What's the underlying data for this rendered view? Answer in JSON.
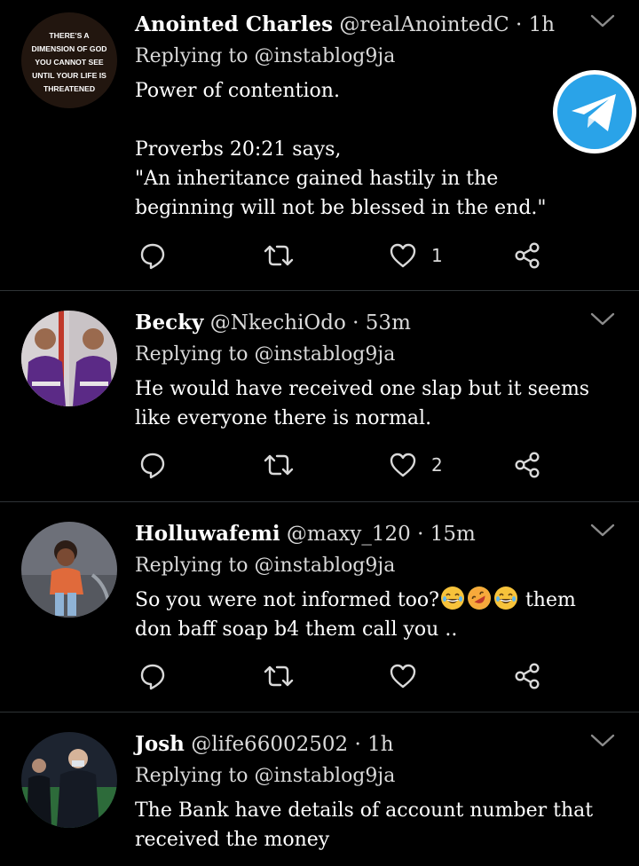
{
  "colors": {
    "background": "#000000",
    "text": "#ffffff",
    "muted": "#d9d9d9",
    "divider": "#2f3336",
    "telegram_blue": "#2aa3e8"
  },
  "floating_button": {
    "icon": "telegram-icon"
  },
  "tweets": [
    {
      "name": "Anointed Charles",
      "handle": "@realAnointedC",
      "separator": "·",
      "time": "1h",
      "replying_to": "Replying to @instablog9ja",
      "body": "Power of contention.\n\nProverbs 20:21 says,\n\"An inheritance gained hastily in the beginning will not be blessed in the end.\"",
      "avatar_text": [
        "THERE'S A",
        "DIMENSION OF GOD",
        "YOU CANNOT SEE",
        "UNTIL YOUR LIFE IS",
        "THREATENED"
      ],
      "likes": "1"
    },
    {
      "name": "Becky",
      "handle": "@NkechiOdo",
      "separator": "·",
      "time": "53m",
      "replying_to": "Replying to @instablog9ja",
      "body": "He would have received one slap but it seems like everyone there is normal.",
      "likes": "2"
    },
    {
      "name": "Holluwafemi",
      "handle": "@maxy_120",
      "separator": "·",
      "time": "15m",
      "replying_to": "Replying to @instablog9ja",
      "body_before": "So you were not informed too?",
      "emojis": [
        "grinning-face-with-tears",
        "rolling-on-floor-laughing",
        "grinning-face-with-tears"
      ],
      "body_after": " them don baff soap b4 them call you ..",
      "likes": ""
    },
    {
      "name": "Josh",
      "handle": "@life66002502",
      "separator": "·",
      "time": "1h",
      "replying_to": "Replying to @instablog9ja",
      "body": "The Bank have details of account number that received the money"
    }
  ]
}
